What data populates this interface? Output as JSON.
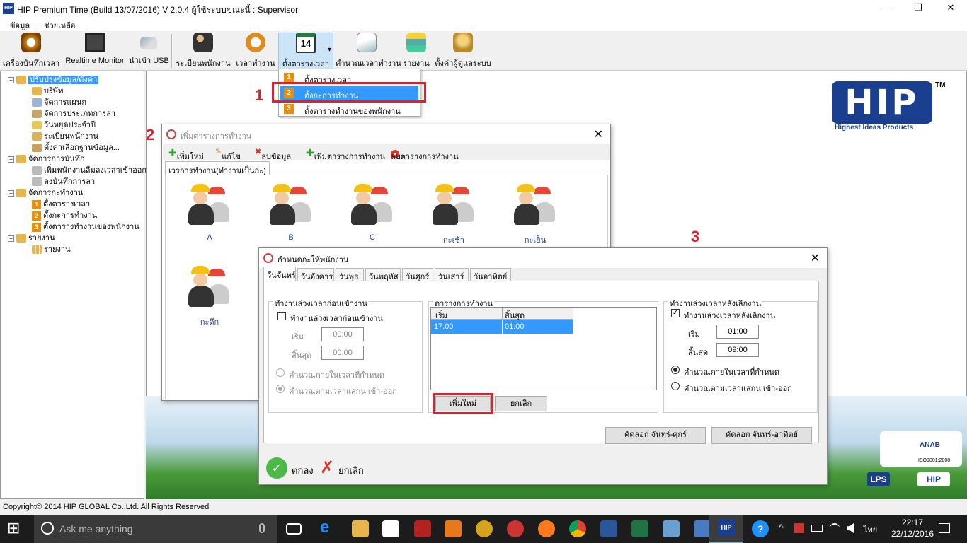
{
  "window": {
    "title": "HIP Premium Time (Build 13/07/2016) V 2.0.4   ผู้ใช้ระบบขณะนี้ : Supervisor",
    "icon_text": "HIP",
    "minimize": "—",
    "maximize": "❐",
    "close": "✕"
  },
  "menu": [
    "ข้อมูล",
    "ช่วยเหลือ"
  ],
  "toolbar": [
    {
      "label": "เครื่องบันทึกเวลา",
      "icon": "clock-icon"
    },
    {
      "label": "Realtime Monitor",
      "icon": "monitor-icon"
    },
    {
      "label": "นำเข้า USB",
      "icon": "usb-icon"
    },
    {
      "label": "ระเบียนพนักงาน",
      "icon": "employees-icon"
    },
    {
      "label": "เวลาทำงาน",
      "icon": "stopwatch-icon"
    },
    {
      "label": "ตั้งตารางเวลา",
      "icon": "calendar-icon",
      "calendar_num": "14",
      "arrow": "▾"
    },
    {
      "label": "คำนวณเวลาทำงาน",
      "icon": "calculate-icon"
    },
    {
      "label": "รายงาน",
      "icon": "report-icon"
    },
    {
      "label": "ตั้งค่าผู้ดูแลระบบ",
      "icon": "admin-icon"
    }
  ],
  "dropdown": [
    {
      "num": "1",
      "label": "ตั้งตารางเวลา"
    },
    {
      "num": "2",
      "label": "ตั้งกะการทำงาน"
    },
    {
      "num": "3",
      "label": "ตั้งตารางทำงานของพนักงาน"
    }
  ],
  "annotations": {
    "one": "1",
    "two": "2",
    "three": "3"
  },
  "tree": {
    "expand": "−",
    "items": [
      {
        "label": "ปรับปรุงข้อมูล/ตั้งค่า"
      },
      {
        "label": "บริษัท"
      },
      {
        "label": "จัดการแผนก"
      },
      {
        "label": "จัดการประเภทการลา"
      },
      {
        "label": "วันหยุดประจำปี"
      },
      {
        "label": "ระเบียนพนักงาน"
      },
      {
        "label": "ตั้งค่าเลือกฐานข้อมูล..."
      },
      {
        "label": "จัดการการบันทึก"
      },
      {
        "label": "เพิ่มพนักงานลืมลงเวลาเข้าออก"
      },
      {
        "label": "ลงบันทึกการลา"
      },
      {
        "label": "จัดการกะทำงาน"
      },
      {
        "label": "ตั้งตารางเวลา",
        "num": "1"
      },
      {
        "label": "ตั้งกะการทำงาน",
        "num": "2"
      },
      {
        "label": "ตั้งตารางทำงานของพนักงาน",
        "num": "3"
      },
      {
        "label": "รายงาน"
      },
      {
        "label": "รายงาน"
      }
    ]
  },
  "logo": {
    "text": "HIP",
    "tm": "TM",
    "tagline": "Highest Ideas Products",
    "iso": "ISO9001:2008",
    "anab": "ANAB",
    "lps": "LPS"
  },
  "shift_dialog": {
    "title": "เพิ่มตารางการทำงาน",
    "close": "✕",
    "toolbar": {
      "add": "เพิ่มใหม่",
      "edit": "แก้ไข",
      "delete": "ลบข้อมูล",
      "add_schedule": "เพิ่มตารางการทำงาน",
      "delete_schedule": "ลบตารางการทำงาน"
    },
    "tab": "เวรการทำงาน(ทำงานเป็นกะ)",
    "shifts": [
      "A",
      "B",
      "C",
      "กะเช้า",
      "กะเย็น",
      "กะดึก"
    ]
  },
  "assign_dialog": {
    "title": "กำหนดกะให้พนักงาน",
    "close": "✕",
    "tabs": [
      "วันจันทร์",
      "วันอังคาร",
      "วันพุธ",
      "วันพฤหัส",
      "วันศุกร์",
      "วันเสาร์",
      "วันอาทิตย์"
    ],
    "before": {
      "title": "ทำงานล่วงเวลาก่อนเข้างาน",
      "check_label": "ทำงานล่วงเวลาก่อนเข้างาน",
      "start_label": "เริ่ม",
      "start": "00:00",
      "end_label": "สิ้นสุด",
      "end": "00:00",
      "radio1": "คำนวณภายในเวลาที่กำหนด",
      "radio2": "คำนวณตามเวลาแสกน เข้า-ออก"
    },
    "schedule": {
      "title": "ตารางการทำงาน",
      "col_start": "เริ่ม",
      "col_end": "สิ้นสุด",
      "rows": [
        {
          "start": "17:00",
          "end": "01:00"
        }
      ],
      "add": "เพิ่มใหม่",
      "cancel": "ยกเลิก"
    },
    "after": {
      "title": "ทำงานล่วงเวลาหลังเลิกงาน",
      "check_label": "ทำงานล่วงเวลาหลังเลิกงาน",
      "check_mark": "✓",
      "start_label": "เริ่ม",
      "start": "01:00",
      "end_label": "สิ้นสุด",
      "end": "09:00",
      "radio1": "คำนวณภายในเวลาที่กำหนด",
      "radio2": "คำนวณตามเวลาแสกน เข้า-ออก"
    },
    "copy_mon_fri": "คัดลอก จันทร์-ศุกร์",
    "copy_mon_sun": "คัดลอก จันทร์-อาทิตย์",
    "ok": "ตกลง",
    "cancel": "ยกเลิก"
  },
  "status": "Copyright© 2014 HIP GLOBAL Co.,Ltd. All Rights Reserved",
  "taskbar": {
    "search": "Ask me anything",
    "lang": "ไทย",
    "time": "22:17",
    "date": "22/12/2016",
    "windows_icon": "⊞",
    "up_arrow": "^",
    "help": "?"
  }
}
